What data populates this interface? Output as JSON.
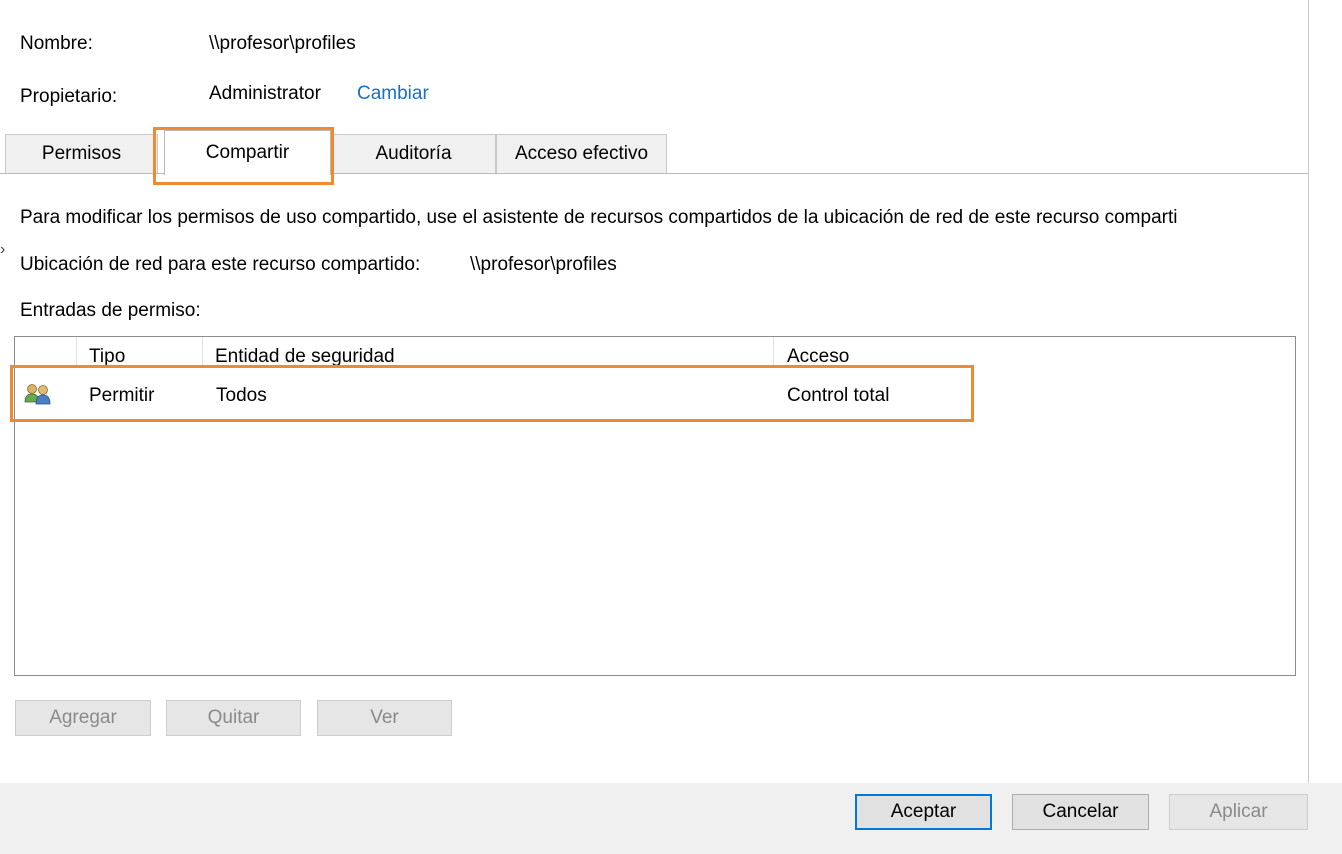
{
  "owner_info": {
    "name_label": "Nombre:",
    "name_value": "\\\\profesor\\profiles",
    "owner_label": "Propietario:",
    "owner_value": "Administrator",
    "change_link": "Cambiar"
  },
  "tabs": [
    {
      "label": "Permisos",
      "active": false
    },
    {
      "label": "Compartir",
      "active": true
    },
    {
      "label": "Auditoría",
      "active": false
    },
    {
      "label": "Acceso efectivo",
      "active": false
    }
  ],
  "share": {
    "info_text": "Para modificar los permisos de uso compartido, use el asistente de recursos compartidos de la ubicación de red de este recurso comparti",
    "location_label": "Ubicación de red para este recurso compartido:",
    "location_value": "\\\\profesor\\profiles",
    "entries_label": "Entradas de permiso:"
  },
  "permission_list": {
    "columns": [
      "Tipo",
      "Entidad de seguridad",
      "Acceso"
    ],
    "rows": [
      {
        "icon": "users-icon",
        "type": "Permitir",
        "principal": "Todos",
        "access": "Control total"
      }
    ]
  },
  "list_buttons": {
    "add": "Agregar",
    "remove": "Quitar",
    "view": "Ver"
  },
  "dialog_buttons": {
    "ok": "Aceptar",
    "cancel": "Cancelar",
    "apply": "Aplicar"
  },
  "colors": {
    "highlight": "#f08a32",
    "link": "#1a6fc7",
    "primary_border": "#0078d7"
  }
}
